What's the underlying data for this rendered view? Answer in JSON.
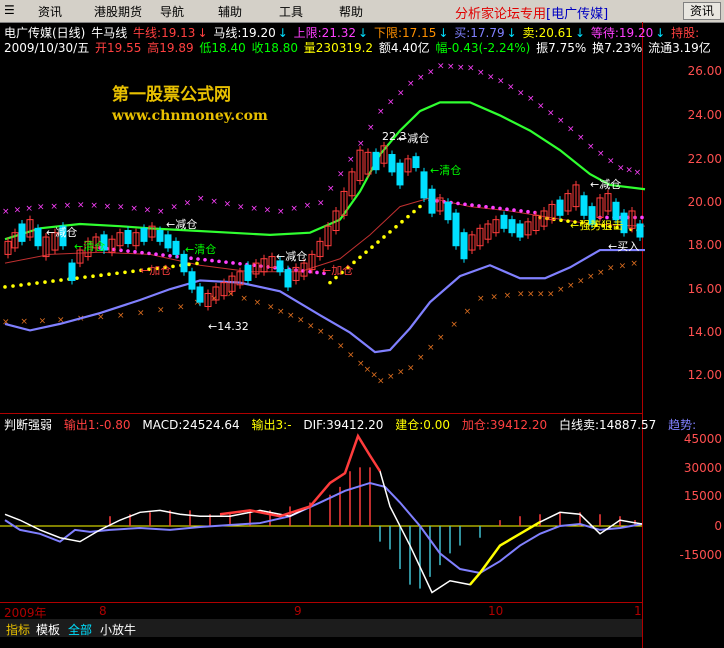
{
  "menu": {
    "items": [
      "资讯",
      "港股期货",
      "导航",
      "辅助",
      "工具",
      "帮助"
    ],
    "forum": "分析家论坛专用",
    "forum_tag": "[电广传媒]",
    "right_button": "资讯"
  },
  "info_line1": {
    "title": "电广传媒(日线)",
    "indicator": "牛马线",
    "niu": "牛线:19.13",
    "ma": "马线:19.20",
    "upper": "上限:21.32",
    "lower": "下限:17.15",
    "buy": "买:17.79",
    "sell": "卖:20.61",
    "wait": "等待:19.20",
    "hold": "持股:"
  },
  "info_line2": {
    "date": "2009/10/30/五",
    "open": "开19.55",
    "high": "高19.89",
    "low": "低18.40",
    "close": "收18.80",
    "vol": "量230319.2",
    "amount": "额4.40亿",
    "change": "幅-0.43(-2.24%)",
    "amplitude": "振7.75%",
    "turnover": "换7.23%",
    "float": "流通3.19亿"
  },
  "watermark": {
    "line1": "第一股票公式网",
    "line2": "www.chnmoney.com"
  },
  "price_axis": [
    "26.00",
    "24.00",
    "22.00",
    "20.00",
    "18.00",
    "16.00",
    "14.00",
    "12.00"
  ],
  "signals": [
    {
      "text": "←减仓",
      "color": "#ffffff"
    },
    {
      "text": "←清仓",
      "color": "#00ff00"
    },
    {
      "text": "←减仓",
      "color": "#ffffff"
    },
    {
      "text": "←加仓",
      "color": "#ff4040"
    },
    {
      "text": "←清仓",
      "color": "#00ff00"
    },
    {
      "text": "←减仓",
      "color": "#ffffff"
    },
    {
      "text": "←加仓",
      "color": "#ff4040"
    },
    {
      "text": "22.3",
      "color": "#ffffff"
    },
    {
      "text": "←减仓",
      "color": "#ffffff"
    },
    {
      "text": "←清仓",
      "color": "#00ff00"
    },
    {
      "text": "←减仓",
      "color": "#ffffff"
    },
    {
      "text": "←强势狙击",
      "color": "#ffff00"
    },
    {
      "text": "←买入",
      "color": "#ffffff"
    },
    {
      "text": "←14.32",
      "color": "#ffffff"
    }
  ],
  "sub_info": {
    "title": "判断强弱",
    "out1": "输出1:-0.80",
    "macd": "MACD:24524.64",
    "out3": "输出3:-",
    "dif": "DIF:39412.20",
    "build": "建仓:0.00",
    "add": "加仓:39412.20",
    "white": "白线卖:14887.57",
    "trend": "趋势:"
  },
  "sub_axis": [
    "45000",
    "30000",
    "15000",
    "0",
    "-15000"
  ],
  "x_axis": [
    "2009年",
    "8",
    "9",
    "10",
    "1"
  ],
  "bottom_tabs": [
    "指标",
    "模板",
    "全部",
    "小放牛"
  ],
  "colors": {
    "up": "#ff3c3c",
    "down": "#00e0ff",
    "green_line": "#30ff30",
    "blue_line": "#8080ff",
    "magenta": "#ff40ff",
    "yellow": "#ffff00"
  }
}
